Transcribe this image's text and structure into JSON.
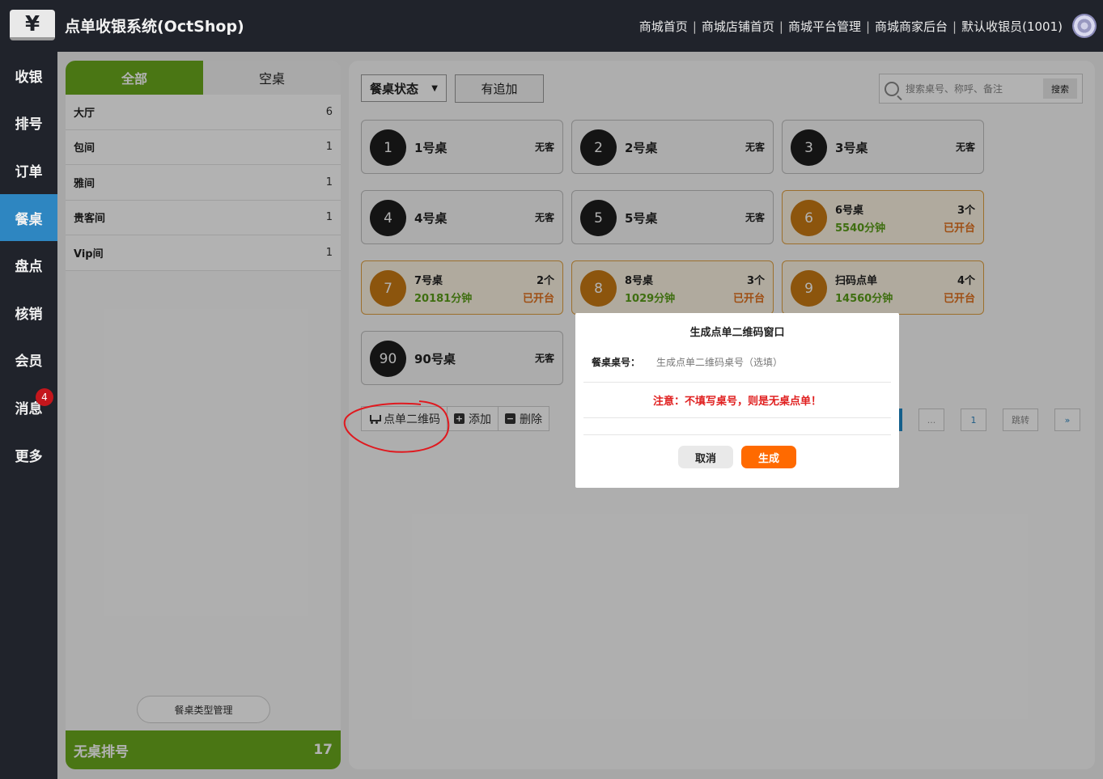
{
  "header": {
    "logo_glyph": "¥",
    "title": "点单收银系统(OctShop)",
    "links": [
      "商城首页",
      "商城店铺首页",
      "商城平台管理",
      "商城商家后台",
      "默认收银员(1001)"
    ]
  },
  "sidenav": {
    "items": [
      {
        "label": "收银"
      },
      {
        "label": "排号"
      },
      {
        "label": "订单"
      },
      {
        "label": "餐桌",
        "active": true
      },
      {
        "label": "盘点"
      },
      {
        "label": "核销"
      },
      {
        "label": "会员"
      },
      {
        "label": "消息",
        "badge": "4"
      },
      {
        "label": "更多"
      }
    ]
  },
  "categories": {
    "tabs": [
      "全部",
      "空桌"
    ],
    "rows": [
      {
        "name": "大厅",
        "count": "6"
      },
      {
        "name": "包间",
        "count": "1"
      },
      {
        "name": "雅间",
        "count": "1"
      },
      {
        "name": "贵客间",
        "count": "1"
      },
      {
        "name": "Vip间",
        "count": "1"
      }
    ],
    "manage_label": "餐桌类型管理",
    "noseat_label": "无桌排号",
    "noseat_count": "17"
  },
  "toolbar": {
    "status_select": "餐桌状态",
    "addon_button": "有追加",
    "search_placeholder": "搜索桌号、称呼、备注",
    "search_button": "搜索"
  },
  "tables": [
    {
      "num": "1",
      "name": "1号桌",
      "status": "无客"
    },
    {
      "num": "2",
      "name": "2号桌",
      "status": "无客"
    },
    {
      "num": "3",
      "name": "3号桌",
      "status": "无客"
    },
    {
      "num": "4",
      "name": "4号桌",
      "status": "无客"
    },
    {
      "num": "5",
      "name": "5号桌",
      "status": "无客"
    },
    {
      "num": "6",
      "name": "6号桌",
      "count": "3个",
      "time": "5540分钟",
      "open": "已开台"
    },
    {
      "num": "7",
      "name": "7号桌",
      "count": "2个",
      "time": "20181分钟",
      "open": "已开台"
    },
    {
      "num": "8",
      "name": "8号桌",
      "count": "3个",
      "time": "1029分钟",
      "open": "已开台"
    },
    {
      "num": "9",
      "name": "扫码点单",
      "count": "4个",
      "time": "14560分钟",
      "open": "已开台"
    },
    {
      "num": "90",
      "name": "90号桌",
      "status": "无客"
    }
  ],
  "actions": {
    "qrcode": "点单二维码",
    "add": "添加",
    "delete": "删除"
  },
  "pager": {
    "current": "1",
    "ellipsis": "...",
    "last": "1",
    "jump": "跳转",
    "next": "»"
  },
  "modal": {
    "title": "生成点单二维码窗口",
    "field_label": "餐桌桌号：",
    "field_placeholder": "生成点单二维码桌号（选填）",
    "notice": "注意：不填写桌号，则是无桌点单！",
    "cancel": "取消",
    "generate": "生成"
  },
  "colors": {
    "accent_green": "#6aaa1e",
    "nav_active": "#2e86c1",
    "busy_orange": "#c97a13",
    "generate_orange": "#ff6a00",
    "notice_red": "#e02020"
  }
}
